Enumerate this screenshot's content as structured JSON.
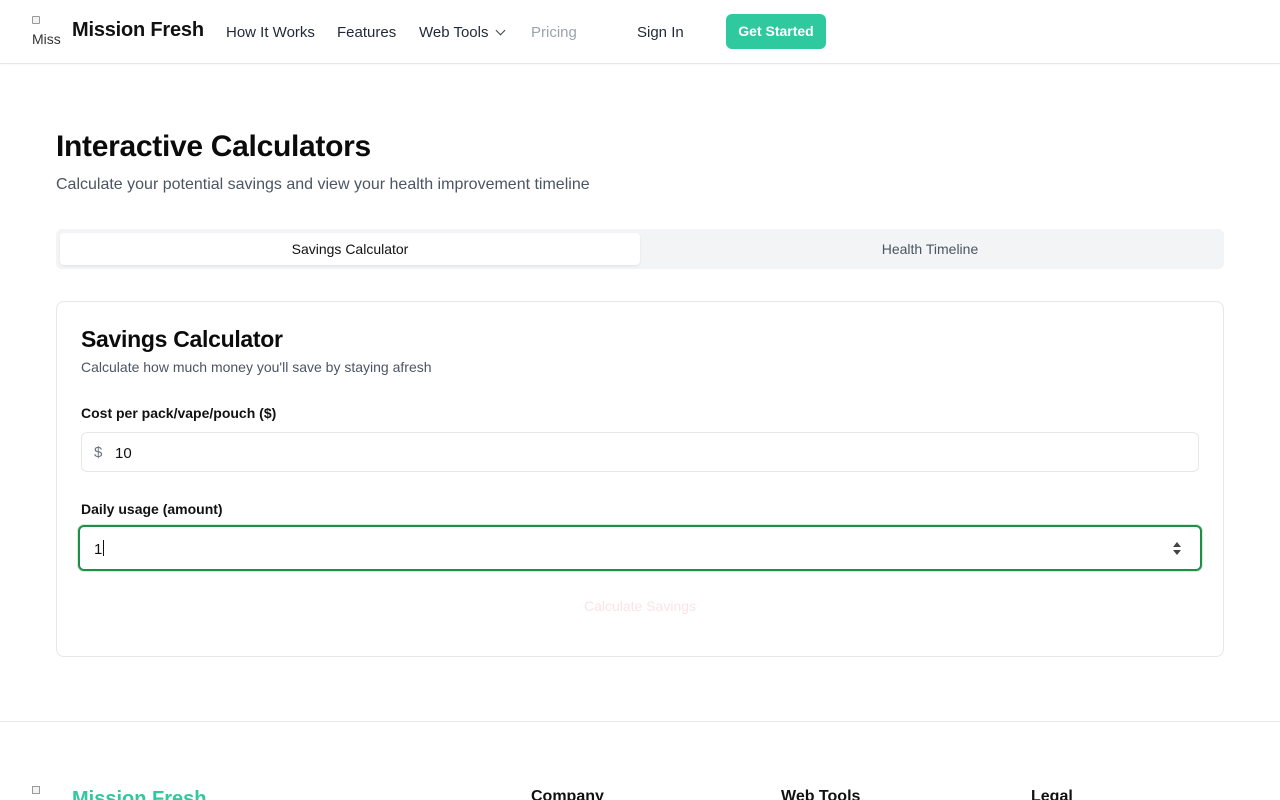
{
  "header": {
    "logo_alt": "Miss",
    "brand": "Mission Fresh",
    "nav": {
      "how_it_works": "How It Works",
      "features": "Features",
      "web_tools": "Web Tools",
      "pricing": "Pricing"
    },
    "sign_in": "Sign In",
    "get_started": "Get Started",
    "accent_color": "#2fc9a0"
  },
  "main": {
    "title": "Interactive Calculators",
    "subtitle": "Calculate your potential savings and view your health improvement timeline",
    "tabs": [
      {
        "label": "Savings Calculator",
        "active": true
      },
      {
        "label": "Health Timeline",
        "active": false
      }
    ],
    "card": {
      "title": "Savings Calculator",
      "subtitle": "Calculate how much money you'll save by staying afresh",
      "cost_label": "Cost per pack/vape/pouch ($)",
      "cost_prefix": "$",
      "cost_value": "10",
      "usage_label": "Daily usage (amount)",
      "usage_value": "1",
      "calculate_label": "Calculate Savings"
    }
  },
  "footer": {
    "brand": "Mission Fresh",
    "columns": [
      "Company",
      "Web Tools",
      "Legal"
    ]
  }
}
